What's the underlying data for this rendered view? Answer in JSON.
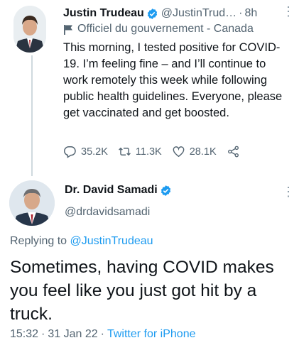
{
  "parent_tweet": {
    "name": "Justin Trudeau",
    "handle": "@JustinTrud…",
    "separator": "·",
    "time": "8h",
    "label": "Officiel du gouvernement - Canada",
    "text": "This morning, I tested positive for COVID-19. I’m feeling fine – and I’ll continue to work remotely this week while following public health guidelines. Everyone, please get vaccinated and get boosted.",
    "replies": "35.2K",
    "retweets": "11.3K",
    "likes": "28.1K"
  },
  "main_tweet": {
    "name": "Dr. David Samadi",
    "handle": "@drdavidsamadi",
    "replying_prefix": "Replying to",
    "replying_to": "@JustinTrudeau",
    "text": "Sometimes, having COVID makes you feel like you just got hit by a truck.",
    "time": "15:32",
    "date": "31 Jan 22",
    "separator": "·",
    "source": "Twitter for iPhone"
  },
  "colors": {
    "accent": "#1d9bf0",
    "secondary_text": "#536471",
    "verified": "#1d9bf0"
  },
  "icons": [
    "verified-badge-icon",
    "government-flag-icon",
    "reply-icon",
    "retweet-icon",
    "like-icon",
    "share-icon",
    "more-options-icon"
  ]
}
